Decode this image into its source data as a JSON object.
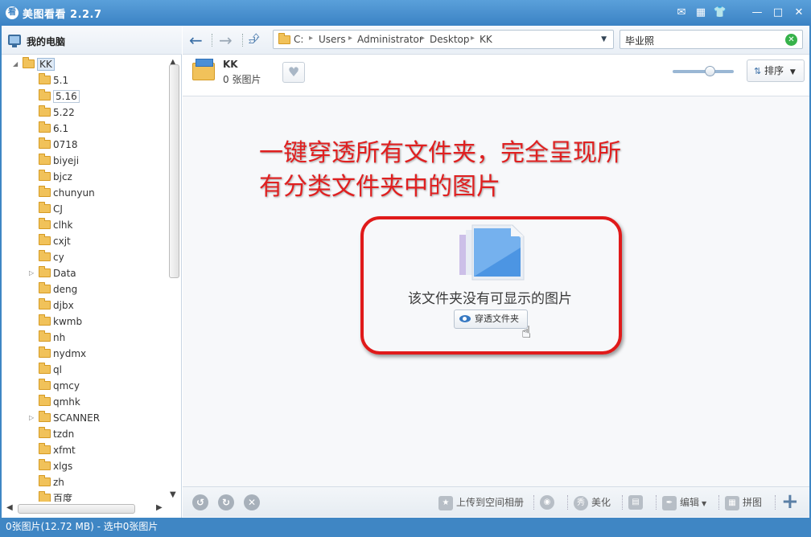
{
  "window": {
    "title": "美图看看 2.2.7",
    "app_icon_text": "看"
  },
  "sidebar": {
    "header": "我的电脑",
    "tree": [
      {
        "label": "KK",
        "level": 0,
        "expanded": true,
        "selected": true
      },
      {
        "label": "5.1",
        "level": 1
      },
      {
        "label": "5.16",
        "level": 1,
        "hover": true
      },
      {
        "label": "5.22",
        "level": 1
      },
      {
        "label": "6.1",
        "level": 1
      },
      {
        "label": "0718",
        "level": 1
      },
      {
        "label": "biyeji",
        "level": 1
      },
      {
        "label": "bjcz",
        "level": 1
      },
      {
        "label": "chunyun",
        "level": 1
      },
      {
        "label": "CJ",
        "level": 1
      },
      {
        "label": "clhk",
        "level": 1
      },
      {
        "label": "cxjt",
        "level": 1
      },
      {
        "label": "cy",
        "level": 1
      },
      {
        "label": "Data",
        "level": 1,
        "expandable": true
      },
      {
        "label": "deng",
        "level": 1
      },
      {
        "label": "djbx",
        "level": 1
      },
      {
        "label": "kwmb",
        "level": 1
      },
      {
        "label": "nh",
        "level": 1
      },
      {
        "label": "nydmx",
        "level": 1
      },
      {
        "label": "ql",
        "level": 1
      },
      {
        "label": "qmcy",
        "level": 1
      },
      {
        "label": "qmhk",
        "level": 1
      },
      {
        "label": "SCANNER",
        "level": 1,
        "expandable": true
      },
      {
        "label": "tzdn",
        "level": 1
      },
      {
        "label": "xfmt",
        "level": 1
      },
      {
        "label": "xlgs",
        "level": 1
      },
      {
        "label": "zh",
        "level": 1
      },
      {
        "label": "百度",
        "level": 1
      }
    ]
  },
  "address": {
    "crumbs": [
      "C:",
      "Users",
      "Administrator",
      "Desktop",
      "KK"
    ]
  },
  "search": {
    "value": "毕业照"
  },
  "folder_info": {
    "name": "KK",
    "count": "0 张图片"
  },
  "sort": {
    "label": "排序"
  },
  "content": {
    "headline_line1": "一键穿透所有文件夹，完全呈现所",
    "headline_line2": "有分类文件夹中的图片",
    "empty_message": "该文件夹没有可显示的图片",
    "penetrate_button": "穿透文件夹"
  },
  "bottombar": {
    "upload": "上传到空间相册",
    "beautify": "美化",
    "edit": "编辑",
    "collage": "拼图"
  },
  "status": {
    "text": "0张图片(12.72 MB) - 选中0张图片"
  },
  "colors": {
    "accent": "#3f86c4",
    "annotation_red": "#e01a1a"
  }
}
